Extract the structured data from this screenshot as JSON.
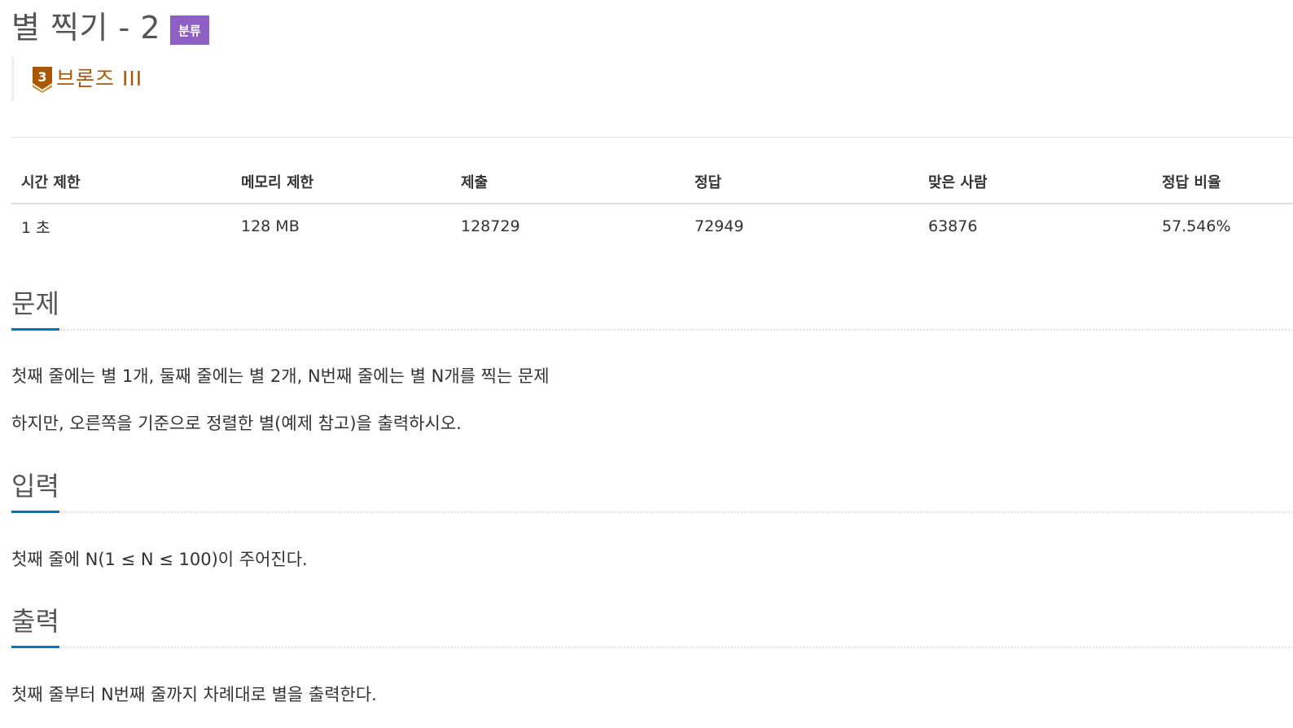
{
  "problem": {
    "title": "별 찍기 - 2",
    "tag_label": "분류",
    "tier_number": "3",
    "tier_label": "브론즈 III",
    "tier_color": "#ad5600"
  },
  "info_table": {
    "headers": [
      "시간 제한",
      "메모리 제한",
      "제출",
      "정답",
      "맞은 사람",
      "정답 비율"
    ],
    "values": [
      "1 초",
      "128 MB",
      "128729",
      "72949",
      "63876",
      "57.546%"
    ]
  },
  "sections": {
    "description": {
      "title": "문제",
      "lines": [
        "첫째 줄에는 별 1개, 둘째 줄에는 별 2개, N번째 줄에는 별 N개를 찍는 문제",
        "하지만, 오른쪽을 기준으로 정렬한 별(예제 참고)을 출력하시오."
      ]
    },
    "input": {
      "title": "입력",
      "lines": [
        "첫째 줄에 N(1 ≤ N ≤ 100)이 주어진다."
      ]
    },
    "output": {
      "title": "출력",
      "lines": [
        "첫째 줄부터 N번째 줄까지 차례대로 별을 출력한다."
      ]
    }
  },
  "colors": {
    "section_underline": "#0076c0",
    "tag_badge": "#8e5fc4"
  }
}
